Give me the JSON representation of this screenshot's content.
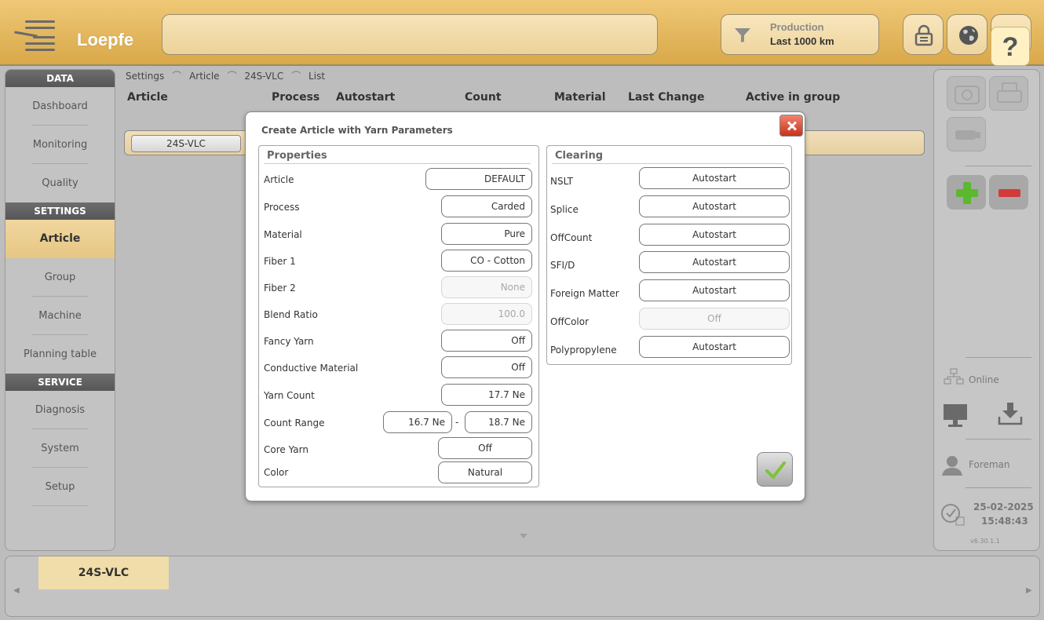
{
  "header": {
    "brand": "Loepfe",
    "search_value": "",
    "filter": {
      "line1": "Production",
      "line2": "Last 1000 km"
    },
    "help_label": "?"
  },
  "leftnav": {
    "sections": [
      {
        "title": "DATA",
        "items": [
          "Dashboard",
          "Monitoring",
          "Quality"
        ]
      },
      {
        "title": "SETTINGS",
        "items": [
          "Article",
          "Group",
          "Machine",
          "Planning table"
        ]
      },
      {
        "title": "SERVICE",
        "items": [
          "Diagnosis",
          "System",
          "Setup"
        ]
      }
    ],
    "active_item": "Article"
  },
  "breadcrumb": [
    "Settings",
    "Article",
    "24S-VLC",
    "List"
  ],
  "list": {
    "columns": [
      "Article",
      "Process",
      "Autostart",
      "Count",
      "Material",
      "Last Change",
      "Active in group"
    ],
    "rows": [
      {
        "article": "24S-VLC"
      }
    ]
  },
  "dialog": {
    "title": "Create Article with Yarn Parameters",
    "properties": {
      "title": "Properties",
      "rows": [
        {
          "label": "Article",
          "value": "DEFAULT",
          "enabled": true
        },
        {
          "label": "Process",
          "value": "Carded",
          "enabled": true
        },
        {
          "label": "Material",
          "value": "Pure",
          "enabled": true
        },
        {
          "label": "Fiber 1",
          "value": "CO - Cotton",
          "enabled": true
        },
        {
          "label": "Fiber 2",
          "value": "None",
          "enabled": false
        },
        {
          "label": "Blend Ratio",
          "value": "100.0",
          "enabled": false
        },
        {
          "label": "Fancy Yarn",
          "value": "Off",
          "enabled": true
        },
        {
          "label": "Conductive Material",
          "value": "Off",
          "enabled": true
        },
        {
          "label": "Yarn Count",
          "value": "17.7 Ne",
          "enabled": true
        }
      ],
      "count_range": {
        "label": "Count Range",
        "min": "16.7 Ne",
        "max": "18.7 Ne",
        "separator": "-"
      },
      "core_yarn": {
        "label": "Core Yarn",
        "value": "Off"
      },
      "color": {
        "label": "Color",
        "value": "Natural"
      }
    },
    "clearing": {
      "title": "Clearing",
      "rows": [
        {
          "label": "NSLT",
          "value": "Autostart",
          "enabled": true
        },
        {
          "label": "Splice",
          "value": "Autostart",
          "enabled": true
        },
        {
          "label": "OffCount",
          "value": "Autostart",
          "enabled": true
        },
        {
          "label": "SFI/D",
          "value": "Autostart",
          "enabled": true
        },
        {
          "label": "Foreign Matter",
          "value": "Autostart",
          "enabled": true
        },
        {
          "label": "OffColor",
          "value": "Off",
          "enabled": false
        },
        {
          "label": "Polypropylene",
          "value": "Autostart",
          "enabled": true
        }
      ]
    }
  },
  "rightpanel": {
    "status": "Online",
    "user": "Foreman",
    "date": "25-02-2025",
    "time": "15:48:43",
    "version": "v6.30.1.1"
  },
  "bottombar": {
    "tabs": [
      "24S-VLC"
    ]
  },
  "colors": {
    "accent": "#e3b95f",
    "active_nav": "#efd59b",
    "close_red": "#d23a22",
    "add_green": "#5cb82e",
    "remove_red": "#d33a3a"
  }
}
